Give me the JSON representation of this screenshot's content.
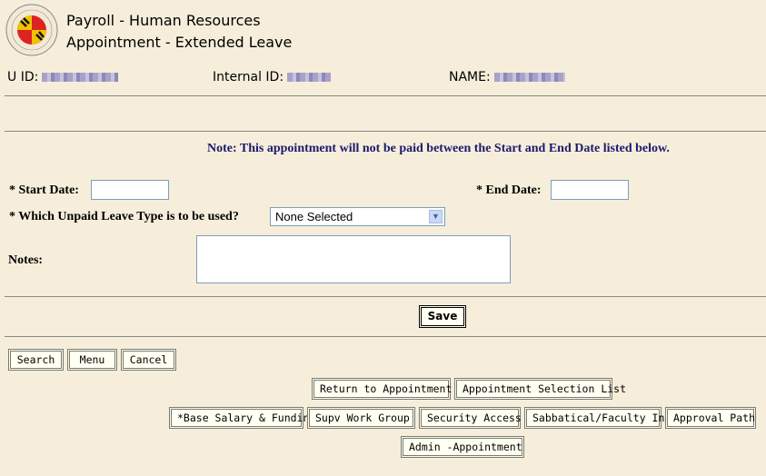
{
  "header": {
    "logo_alt": "University of Maryland seal",
    "title_line1": "Payroll - Human Resources",
    "title_line2": "Appointment - Extended Leave"
  },
  "identity": {
    "uid_label": "U ID:",
    "internal_id_label": "Internal ID:",
    "name_label": "NAME:"
  },
  "note": "Note: This appointment will not be paid between the Start and End Date listed below.",
  "form": {
    "start_date_label": "* Start Date:",
    "start_date_value": "",
    "end_date_label": "* End Date:",
    "end_date_value": "",
    "leave_type_label": "* Which Unpaid Leave Type is to be used?",
    "leave_type_selected": "None Selected",
    "notes_label": "Notes:",
    "notes_value": ""
  },
  "buttons": {
    "save": "Save",
    "search": "Search",
    "menu": "Menu",
    "cancel": "Cancel",
    "return_to_appointment": "Return to Appointment",
    "appointment_selection_list": "Appointment Selection List",
    "base_salary_funding": "*Base Salary & Funding",
    "supv_work_group": "Supv Work Group",
    "security_access": "Security Access",
    "sabbatical_faculty_info": "Sabbatical/Faculty Info",
    "approval_path": "Approval Path",
    "admin_appointment": "Admin -Appointment"
  }
}
